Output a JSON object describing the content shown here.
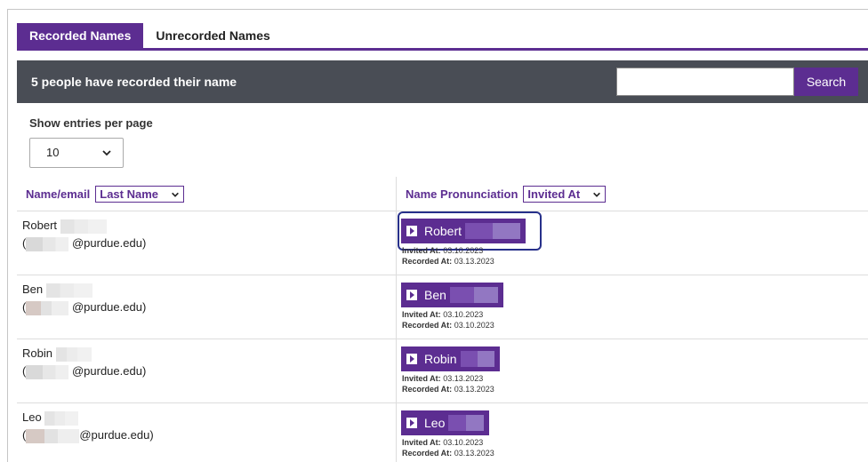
{
  "tabs": [
    {
      "label": "Recorded Names",
      "active": true
    },
    {
      "label": "Unrecorded Names",
      "active": false
    }
  ],
  "header": {
    "title": "5 people have recorded their name",
    "search_placeholder": "",
    "search_label": "Search"
  },
  "entries": {
    "label": "Show entries per page",
    "selected": "10"
  },
  "table": {
    "col1_label": "Name/email",
    "col1_sort": "Last Name",
    "col2_label": "Name Pronunciation",
    "col2_sort": "Invited At",
    "invited_label": "Invited At:",
    "recorded_label": "Recorded At:",
    "rows": [
      {
        "first": "Robert",
        "email_suffix": "@purdue.edu)",
        "invited": "03.10.2023",
        "recorded": "03.13.2023"
      },
      {
        "first": "Ben",
        "email_suffix": "@purdue.edu)",
        "invited": "03.10.2023",
        "recorded": "03.10.2023"
      },
      {
        "first": "Robin",
        "email_suffix": "@purdue.edu)",
        "invited": "03.13.2023",
        "recorded": "03.13.2023"
      },
      {
        "first": "Leo",
        "email_suffix": "@purdue.edu)",
        "invited": "03.10.2023",
        "recorded": "03.13.2023"
      }
    ]
  },
  "colors": {
    "accent": "#5c2d91",
    "header_bg": "#494d55"
  }
}
